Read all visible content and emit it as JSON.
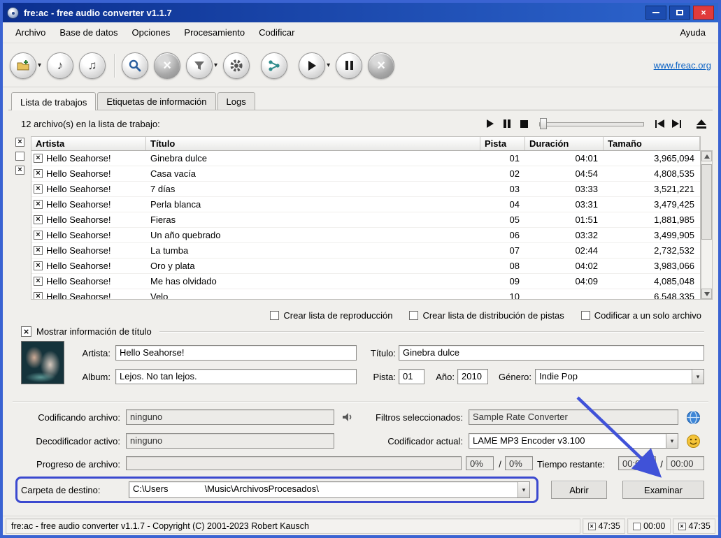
{
  "titlebar": {
    "title": "fre:ac - free audio converter v1.1.7"
  },
  "menubar": {
    "items": [
      "Archivo",
      "Base de datos",
      "Opciones",
      "Procesamiento",
      "Codificar"
    ],
    "help": "Ayuda"
  },
  "toolbar": {
    "website_link": "www.freac.org"
  },
  "tabs": {
    "items": [
      "Lista de trabajos",
      "Etiquetas de información",
      "Logs"
    ],
    "active": "Lista de trabajos"
  },
  "joblist": {
    "summary": "12 archivo(s) en la lista de trabajo:",
    "columns": {
      "artist": "Artista",
      "title": "Título",
      "track": "Pista",
      "duration": "Duración",
      "size": "Tamaño"
    },
    "rows": [
      {
        "artist": "Hello Seahorse!",
        "title": "Ginebra dulce",
        "track": "01",
        "duration": "04:01",
        "size": "3,965,094"
      },
      {
        "artist": "Hello Seahorse!",
        "title": "Casa vacía",
        "track": "02",
        "duration": "04:54",
        "size": "4,808,535"
      },
      {
        "artist": "Hello Seahorse!",
        "title": "7 días",
        "track": "03",
        "duration": "03:33",
        "size": "3,521,221"
      },
      {
        "artist": "Hello Seahorse!",
        "title": "Perla blanca",
        "track": "04",
        "duration": "03:31",
        "size": "3,479,425"
      },
      {
        "artist": "Hello Seahorse!",
        "title": "Fieras",
        "track": "05",
        "duration": "01:51",
        "size": "1,881,985"
      },
      {
        "artist": "Hello Seahorse!",
        "title": "Un año quebrado",
        "track": "06",
        "duration": "03:32",
        "size": "3,499,905"
      },
      {
        "artist": "Hello Seahorse!",
        "title": "La tumba",
        "track": "07",
        "duration": "02:44",
        "size": "2,732,532"
      },
      {
        "artist": "Hello Seahorse!",
        "title": "Oro y plata",
        "track": "08",
        "duration": "04:02",
        "size": "3,983,066"
      },
      {
        "artist": "Hello Seahorse!",
        "title": "Me has olvidado",
        "track": "09",
        "duration": "04:09",
        "size": "4,085,048"
      },
      {
        "artist": "Hello Seahorse!",
        "title": "Velo",
        "track": "10",
        "duration": "",
        "size": "6,548,335"
      }
    ]
  },
  "encode_options": {
    "playlist": "Crear lista de reproducción",
    "cuesheet": "Crear lista de distribución de pistas",
    "single_file": "Codificar a un solo archivo"
  },
  "tag_editor": {
    "section_title": "Mostrar información de título",
    "artist_label": "Artista:",
    "artist_value": "Hello Seahorse!",
    "title_label": "Título:",
    "title_value": "Ginebra dulce",
    "album_label": "Album:",
    "album_value": "Lejos. No tan lejos.",
    "track_label": "Pista:",
    "track_value": "01",
    "year_label": "Año:",
    "year_value": "2010",
    "genre_label": "Género:",
    "genre_value": "Indie Pop"
  },
  "status_panel": {
    "encoding_file_label": "Codificando archivo:",
    "encoding_file_value": "ninguno",
    "active_decoder_label": "Decodificador activo:",
    "active_decoder_value": "ninguno",
    "selected_filters_label": "Filtros seleccionados:",
    "selected_filters_value": "Sample Rate Converter",
    "current_encoder_label": "Codificador actual:",
    "current_encoder_value": "LAME MP3 Encoder v3.100",
    "file_progress_label": "Progreso de archivo:",
    "file_percent": "0%",
    "total_percent": "0%",
    "separator": "/",
    "time_remaining_label": "Tiempo restante:",
    "file_time": "00:00",
    "total_time": "00:00",
    "output_folder_label": "Carpeta de destino:",
    "output_folder_prefix": "C:\\Users",
    "output_folder_suffix": "\\Music\\ArchivosProcesados\\",
    "open_button": "Abrir",
    "browse_button": "Examinar"
  },
  "statusbar": {
    "copyright": "fre:ac - free audio converter v1.1.7 - Copyright (C) 2001-2023 Robert Kausch",
    "selected_total_time": "47:35",
    "elapsed_time": "00:00",
    "remaining_time": "47:35"
  },
  "icons": {
    "check": "×",
    "close": "×",
    "dropdown_arrow": "▾",
    "combo_arrow": "▾",
    "note": "♪",
    "notes": "♫"
  },
  "annotation": {
    "accent_color": "#3b49cf"
  }
}
